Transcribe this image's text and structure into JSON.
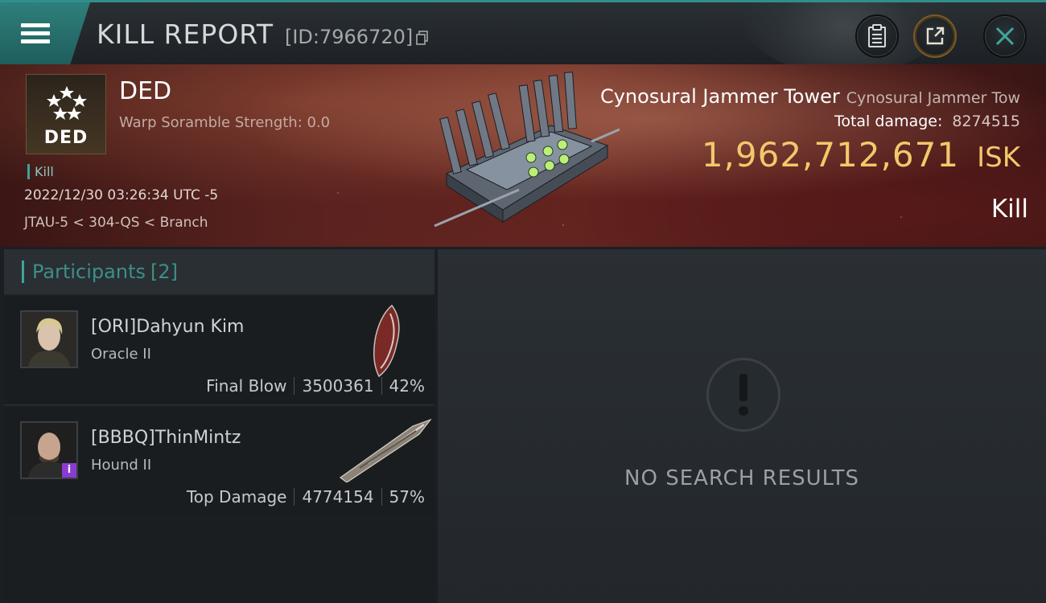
{
  "header": {
    "title": "KILL REPORT",
    "report_id": "[ID:7966720]"
  },
  "banner": {
    "corp_logo_text": "DED",
    "corp_name": "DED",
    "warp_strength": "Warp Soramble Strength: 0.0",
    "kill_tag": "Kill",
    "timestamp": "2022/12/30 03:26:34 UTC -5",
    "location": "JTAU-5 < 304-QS < Branch",
    "victim_name": "Cynosural Jammer Tower",
    "victim_ship": "Cynosural Jammer Tow",
    "total_damage_label": "Total damage:",
    "total_damage_value": "8274515",
    "isk_value": "1,962,712,671",
    "isk_unit": "ISK",
    "kill_type": "Kill"
  },
  "participants": {
    "label": "Participants",
    "count": "[2]",
    "items": [
      {
        "name": "[ORI]Dahyun Kim",
        "ship": "Oracle II",
        "role": "Final Blow",
        "damage": "3500361",
        "percent": "42%"
      },
      {
        "name": "[BBBQ]ThinMintz",
        "ship": "Hound II",
        "role": "Top Damage",
        "damage": "4774154",
        "percent": "57%"
      }
    ]
  },
  "results": {
    "empty_text": "NO SEARCH RESULTS"
  },
  "colors": {
    "accent_teal": "#3aa59d",
    "isk_gold": "#f3c86b"
  }
}
